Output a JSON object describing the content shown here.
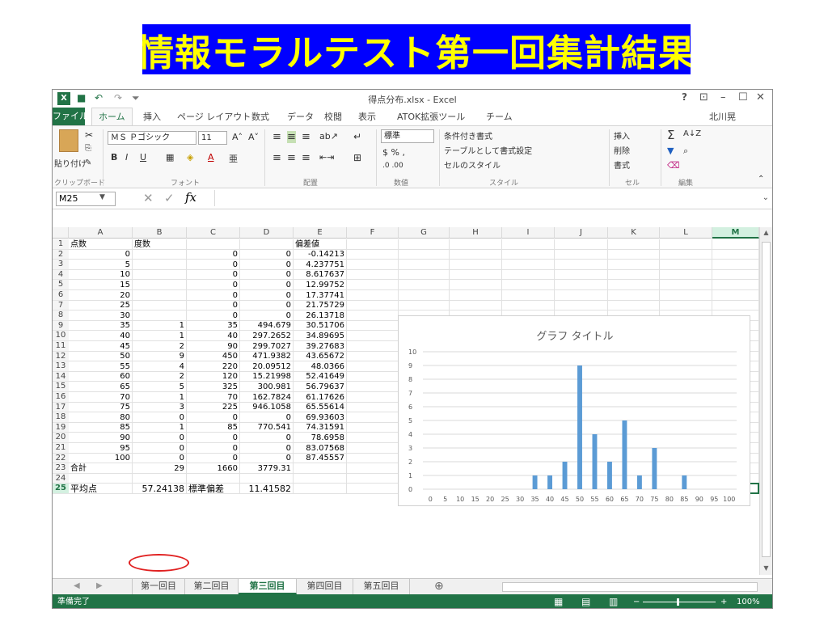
{
  "banner": "情報モラルテスト第一回集計結果",
  "window": {
    "title": "得点分布.xlsx - Excel",
    "help": "?",
    "user": "北川晃"
  },
  "tabs": [
    "ファイル",
    "ホーム",
    "挿入",
    "ページ レイアウト",
    "数式",
    "データ",
    "校閲",
    "表示",
    "ATOK拡張ツール",
    "チーム"
  ],
  "ribbon": {
    "paste": "貼り付け",
    "clipboard": "クリップボード",
    "font_name": "ＭＳ Ｐゴシック",
    "font_size": "11",
    "font_group": "フォント",
    "align_group": "配置",
    "number_format": "標準",
    "number_group": "数値",
    "cond_format": "条件付き書式",
    "table_format": "テーブルとして書式設定",
    "cell_style": "セルのスタイル",
    "style_group": "スタイル",
    "insert": "挿入",
    "delete": "削除",
    "format": "書式",
    "cells_group": "セル",
    "edit_group": "編集",
    "bold": "B",
    "italic": "I",
    "underline": "U"
  },
  "namebox": "M25",
  "formula": {
    "cancel": "✕",
    "enter": "✓",
    "fx": "fx",
    "value": ""
  },
  "columns": [
    "A",
    "B",
    "C",
    "D",
    "E",
    "F",
    "G",
    "H",
    "I",
    "J",
    "K",
    "L",
    "M"
  ],
  "rows": [
    [
      "点数",
      "度数",
      "",
      "",
      "偏差値"
    ],
    [
      "0",
      "",
      "0",
      "0",
      "-0.14213"
    ],
    [
      "5",
      "",
      "0",
      "0",
      "4.237751"
    ],
    [
      "10",
      "",
      "0",
      "0",
      "8.617637"
    ],
    [
      "15",
      "",
      "0",
      "0",
      "12.99752"
    ],
    [
      "20",
      "",
      "0",
      "0",
      "17.37741"
    ],
    [
      "25",
      "",
      "0",
      "0",
      "21.75729"
    ],
    [
      "30",
      "",
      "0",
      "0",
      "26.13718"
    ],
    [
      "35",
      "1",
      "35",
      "494.679",
      "30.51706"
    ],
    [
      "40",
      "1",
      "40",
      "297.2652",
      "34.89695"
    ],
    [
      "45",
      "2",
      "90",
      "299.7027",
      "39.27683"
    ],
    [
      "50",
      "9",
      "450",
      "471.9382",
      "43.65672"
    ],
    [
      "55",
      "4",
      "220",
      "20.09512",
      "48.0366"
    ],
    [
      "60",
      "2",
      "120",
      "15.21998",
      "52.41649"
    ],
    [
      "65",
      "5",
      "325",
      "300.981",
      "56.79637"
    ],
    [
      "70",
      "1",
      "70",
      "162.7824",
      "61.17626"
    ],
    [
      "75",
      "3",
      "225",
      "946.1058",
      "65.55614"
    ],
    [
      "80",
      "0",
      "0",
      "0",
      "69.93603"
    ],
    [
      "85",
      "1",
      "85",
      "770.541",
      "74.31591"
    ],
    [
      "90",
      "0",
      "0",
      "0",
      "78.6958"
    ],
    [
      "95",
      "0",
      "0",
      "0",
      "83.07568"
    ],
    [
      "100",
      "0",
      "0",
      "0",
      "87.45557"
    ],
    [
      "合計",
      "29",
      "1660",
      "3779.31",
      ""
    ],
    [
      "",
      "",
      "",
      "",
      ""
    ],
    [
      "平均点",
      "57.24138",
      "標準偏差",
      "11.41582",
      ""
    ]
  ],
  "sheets": [
    "第一回目",
    "第二回目",
    "第三回目",
    "第四回目",
    "第五回目"
  ],
  "active_sheet": "第三回目",
  "status": {
    "ready": "準備完了",
    "zoom": "100%"
  },
  "colors": {
    "excel_green": "#217346",
    "bar": "#5b9bd5",
    "banner_bg": "#0000ff",
    "banner_fg": "#ffff00",
    "highlight_ring": "#e02020"
  },
  "chart_data": {
    "type": "bar",
    "title": "グラフ タイトル",
    "categories": [
      "0",
      "5",
      "10",
      "15",
      "20",
      "25",
      "30",
      "35",
      "40",
      "45",
      "50",
      "55",
      "60",
      "65",
      "70",
      "75",
      "80",
      "85",
      "90",
      "95",
      "100"
    ],
    "values": [
      0,
      0,
      0,
      0,
      0,
      0,
      0,
      1,
      1,
      2,
      9,
      4,
      2,
      5,
      1,
      3,
      0,
      1,
      0,
      0,
      0
    ],
    "ylim": [
      0,
      10
    ],
    "yticks": [
      "0",
      "1",
      "2",
      "3",
      "4",
      "5",
      "6",
      "7",
      "8",
      "9",
      "10"
    ],
    "grid": true
  }
}
